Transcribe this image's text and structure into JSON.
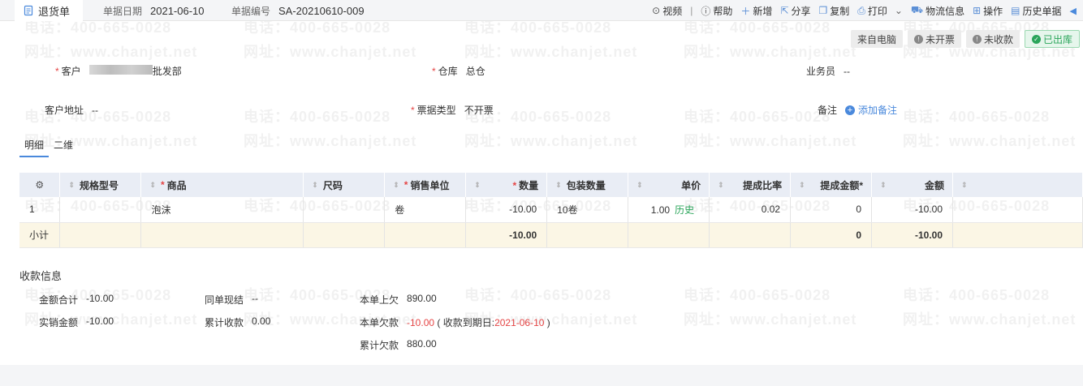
{
  "watermark": {
    "phone": "电话：400-665-0028",
    "site": "网址：www.chanjet.net"
  },
  "header": {
    "doc_title": "退货单",
    "date_label": "单据日期",
    "date_value": "2021-06-10",
    "number_label": "单据编号",
    "number_value": "SA-20210610-009"
  },
  "toolbar": {
    "video": "视频",
    "sep": "|",
    "help": "帮助",
    "add": "新增",
    "share": "分享",
    "copy": "复制",
    "print": "打印",
    "logistics": "物流信息",
    "operate": "操作",
    "history": "历史单据"
  },
  "badges": {
    "from_pc": "来自电脑",
    "not_invoiced": "未开票",
    "not_collected": "未收款",
    "shipped": "已出库"
  },
  "form": {
    "customer_label": "客户",
    "customer_value_suffix": "批发部",
    "warehouse_label": "仓库",
    "warehouse_value": "总仓",
    "salesman_label": "业务员",
    "salesman_value": "--",
    "address_label": "客户地址",
    "address_value": "--",
    "invoice_type_label": "票据类型",
    "invoice_type_value": "不开票",
    "remark_label": "备注",
    "add_remark": "添加备注",
    "required_mark": "*"
  },
  "tabs": [
    "明细",
    "二维"
  ],
  "table": {
    "headers": [
      "规格型号",
      "商品",
      "尺码",
      "销售单位",
      "数量",
      "包装数量",
      "单价",
      "提成比率",
      "提成金额*",
      "金额"
    ],
    "row": {
      "index": "1",
      "spec": "",
      "product": "泡沫",
      "size": "",
      "unit": "卷",
      "qty": "-10.00",
      "pack": "10卷",
      "price": "1.00",
      "price_history": "历史",
      "rate": "0.02",
      "commission": "0",
      "amount": "-10.00"
    },
    "subtotal": {
      "label": "小计",
      "qty": "-10.00",
      "commission": "0",
      "amount": "-10.00"
    }
  },
  "payment": {
    "title": "收款信息",
    "total_label": "金额合计",
    "total_value": "-10.00",
    "actual_label": "实销金额",
    "actual_value": "-10.00",
    "same_cash_label": "同单现结",
    "same_cash_value": "--",
    "cum_received_label": "累计收款",
    "cum_received_value": "0.00",
    "prev_owed_label": "本单上欠",
    "prev_owed_value": "890.00",
    "cur_owed_label": "本单欠款",
    "cur_owed_value": "-10.00",
    "due_open": "( 收款到期日:",
    "due_date": "2021-06-10",
    "due_close": ")",
    "cum_owed_label": "累计欠款",
    "cum_owed_value": "880.00"
  }
}
